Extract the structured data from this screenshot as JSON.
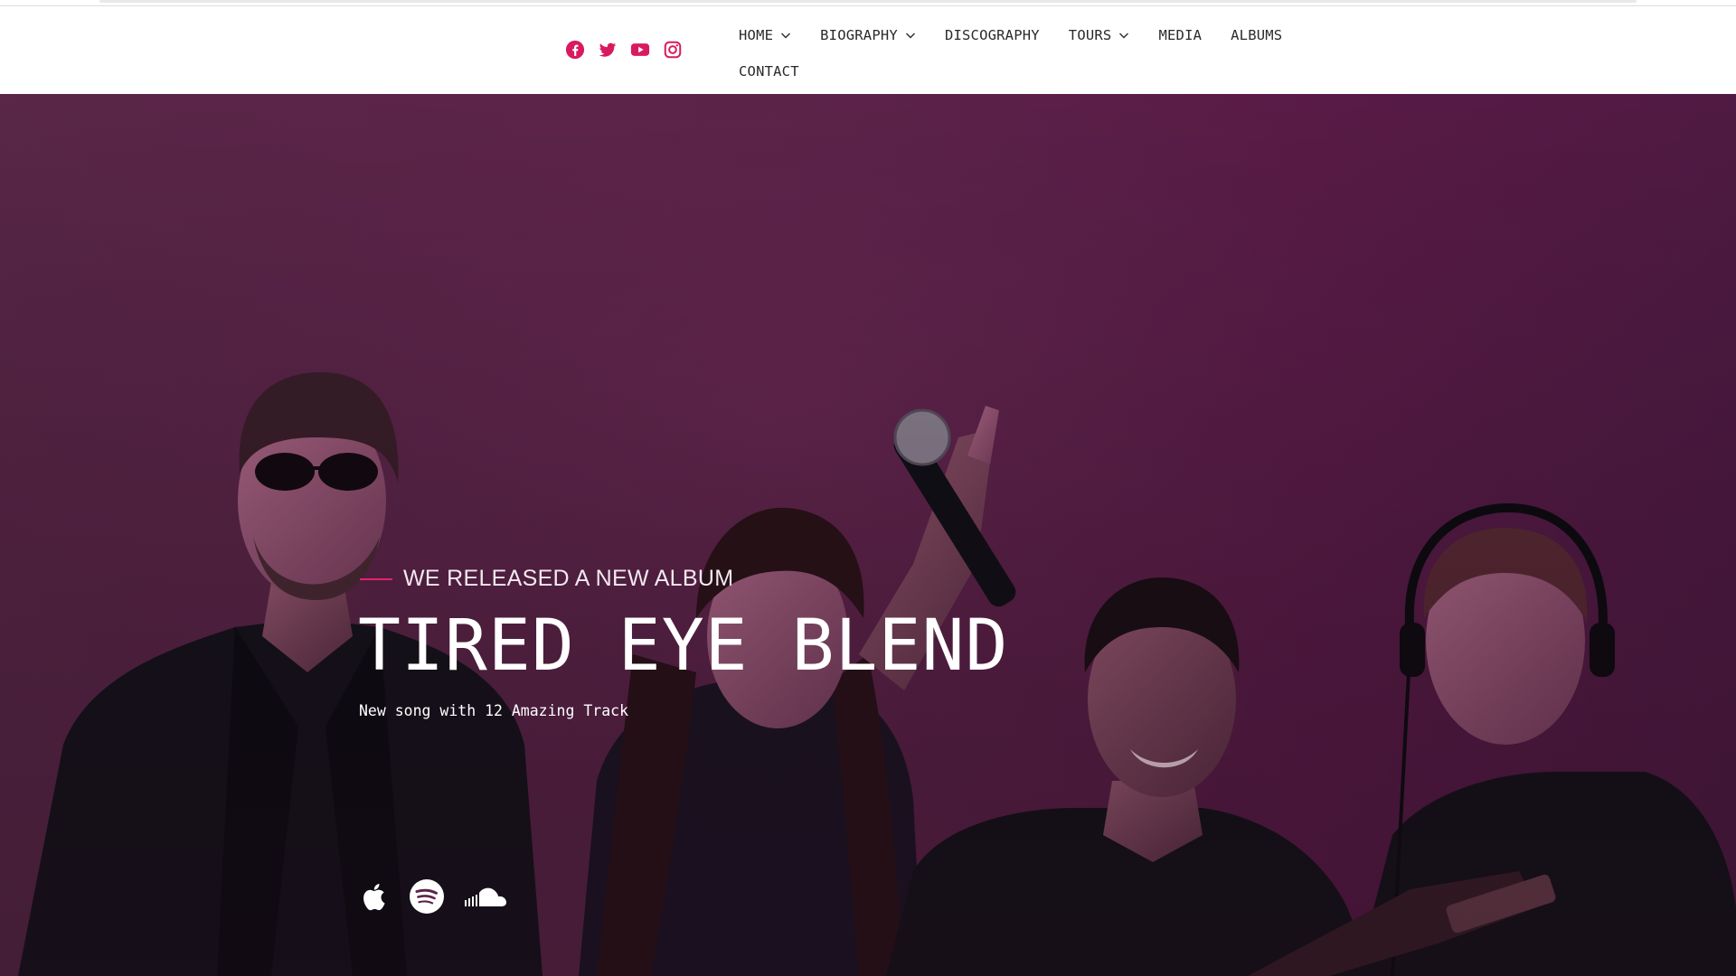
{
  "colors": {
    "accent": "#d81b60",
    "nav_text": "#2a2a2a",
    "hero_bg": "#5c2449",
    "white": "#ffffff"
  },
  "header": {
    "social_icons": [
      "facebook-icon",
      "twitter-icon",
      "youtube-icon",
      "instagram-icon"
    ],
    "nav": {
      "items": [
        {
          "label": "HOME",
          "dropdown": true
        },
        {
          "label": "BIOGRAPHY",
          "dropdown": true
        },
        {
          "label": "DISCOGRAPHY",
          "dropdown": false
        },
        {
          "label": "TOURS",
          "dropdown": true
        },
        {
          "label": "MEDIA",
          "dropdown": false
        },
        {
          "label": "ALBUMS",
          "dropdown": false
        },
        {
          "label": "CONTACT",
          "dropdown": false
        }
      ]
    }
  },
  "hero": {
    "eyebrow": "WE RELEASED A NEW ALBUM",
    "title": "TIRED EYE BLEND",
    "subtitle": "New song with 12 Amazing Track",
    "streaming_icons": [
      "apple-icon",
      "spotify-icon",
      "soundcloud-icon"
    ]
  }
}
